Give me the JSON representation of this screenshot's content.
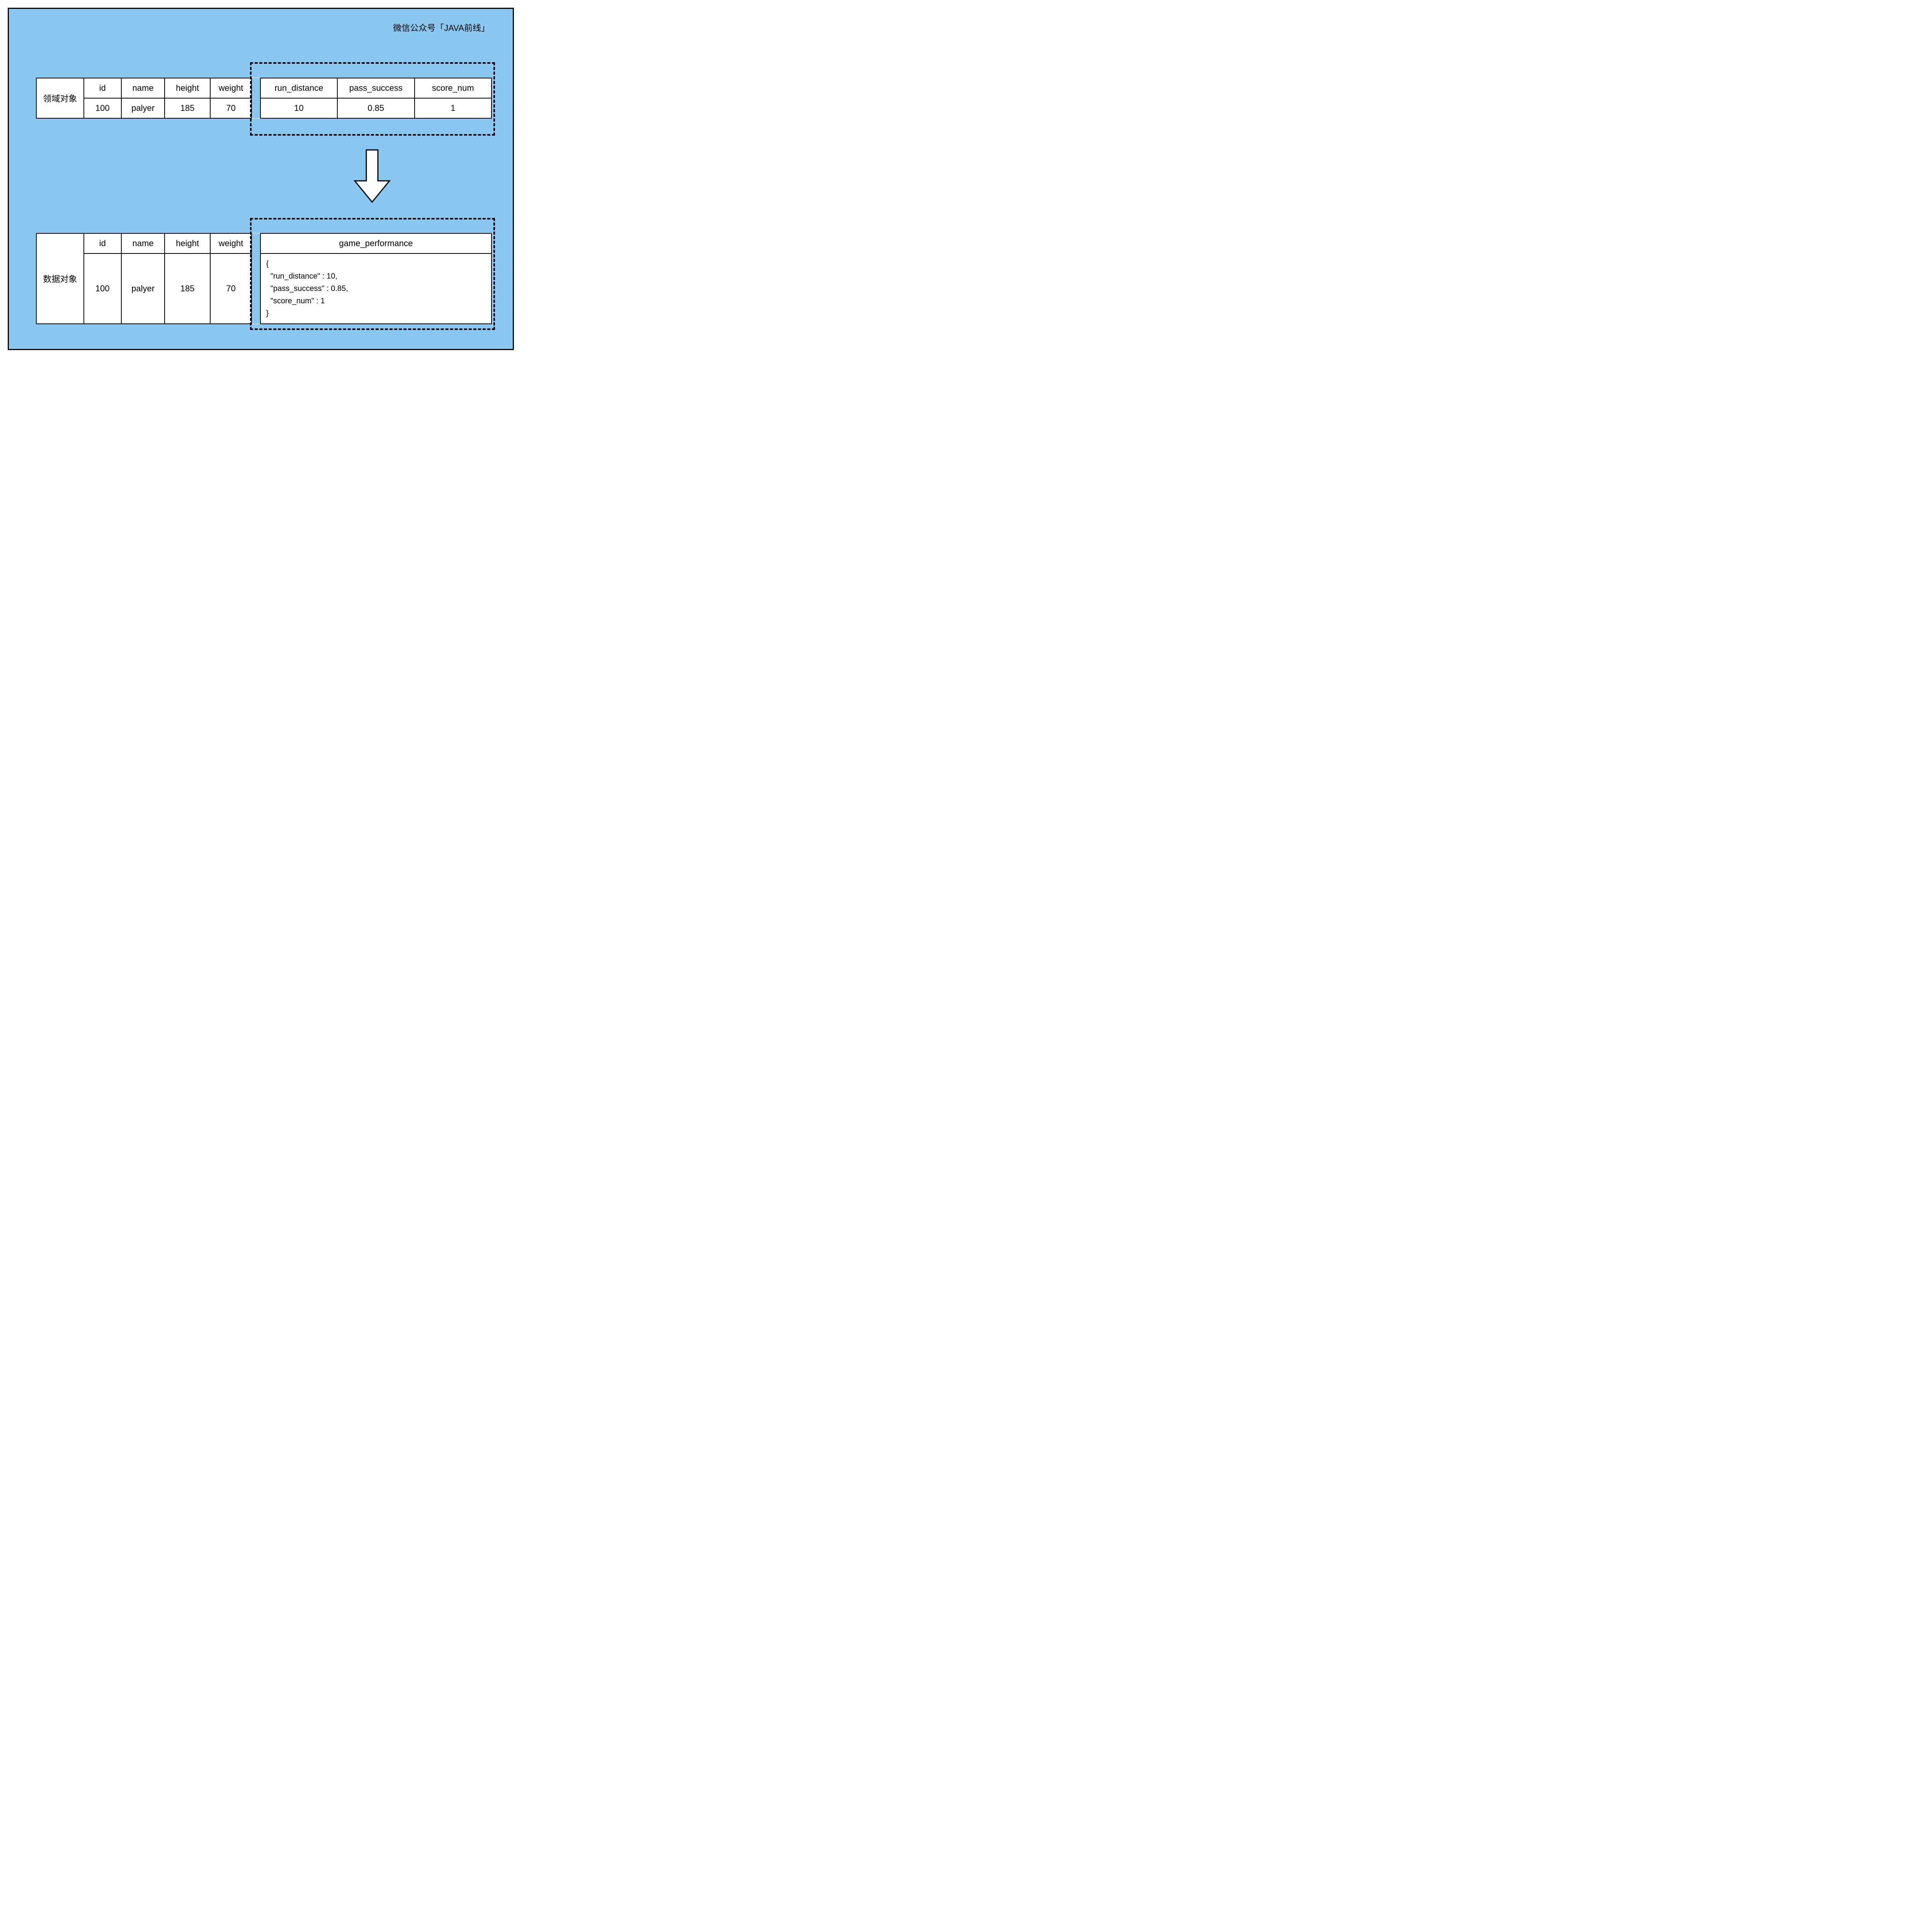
{
  "attribution": "微信公众号「JAVA前线」",
  "top_table": {
    "row_label": "领域对象",
    "headers": [
      "id",
      "name",
      "height",
      "weight",
      "run_distance",
      "pass_success",
      "score_num"
    ],
    "row": [
      "100",
      "palyer",
      "185",
      "70",
      "10",
      "0.85",
      "1"
    ]
  },
  "bottom_table": {
    "row_label": "数据对象",
    "headers": [
      "id",
      "name",
      "height",
      "weight",
      "game_performance"
    ],
    "row": [
      "100",
      "palyer",
      "185",
      "70"
    ],
    "json_value": "{\n  \"run_distance\" : 10,\n  \"pass_success\" : 0.85,\n  \"score_num\" : 1\n}"
  }
}
